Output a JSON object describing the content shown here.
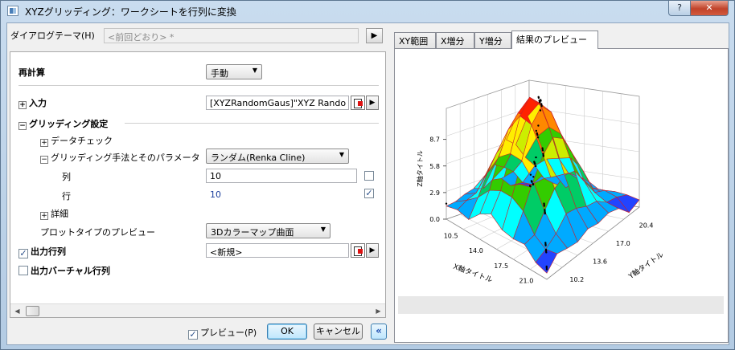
{
  "window": {
    "title": "XYZグリッディング：ワークシートを行列に変換",
    "help_label": "?",
    "close_label": "✕"
  },
  "theme": {
    "label": "ダイアログテーマ(H)",
    "value": "<前回どおり> *",
    "arrow": "▶"
  },
  "settings": {
    "recalc": {
      "label": "再計算",
      "value": "手動"
    },
    "input": {
      "label": "入力",
      "value": "[XYZRandomGaus]\"XYZ Rando"
    },
    "gridding": {
      "label": "グリッディング設定",
      "data_check": "データチェック",
      "method": {
        "label": "グリッディング手法とそのパラメータ",
        "value": "ランダム(Renka Cline)"
      },
      "cols": {
        "label": "列",
        "value": "10",
        "checked": false
      },
      "rows": {
        "label": "行",
        "value": "10",
        "checked": true
      },
      "details": "詳細",
      "plot_type": {
        "label": "プロットタイプのプレビュー",
        "value": "3Dカラーマップ曲面"
      }
    },
    "output_matrix": {
      "label": "出力行列",
      "value": "<新規>",
      "checked": true
    },
    "output_virtual": {
      "label": "出力バーチャル行列",
      "checked": false
    }
  },
  "buttons": {
    "preview_label": "プレビュー(P)",
    "preview_checked": true,
    "ok_label": "OK",
    "cancel_label": "キャンセル",
    "collapse_label": "«"
  },
  "tabs": [
    {
      "label": "XY範囲"
    },
    {
      "label": "X増分"
    },
    {
      "label": "Y増分"
    },
    {
      "label": "結果のプレビュー",
      "active": true
    }
  ],
  "chart_data": {
    "type": "3d-surface",
    "xlabel": "X軸タイトル",
    "ylabel": "Y軸タイトル",
    "zlabel": "Z軸タイトル",
    "x_ticks": [
      "10.5",
      "14.0",
      "17.5",
      "21.0"
    ],
    "y_ticks": [
      "10.2",
      "13.6",
      "17.0",
      "20.4"
    ],
    "z_ticks": [
      "0.0",
      "2.9",
      "5.8",
      "8.7"
    ],
    "colors": [
      "#2244ff",
      "#00aaff",
      "#00ffff",
      "#00cc66",
      "#33cc00",
      "#ccee00",
      "#ffee00",
      "#ff8800",
      "#ff2200"
    ]
  }
}
